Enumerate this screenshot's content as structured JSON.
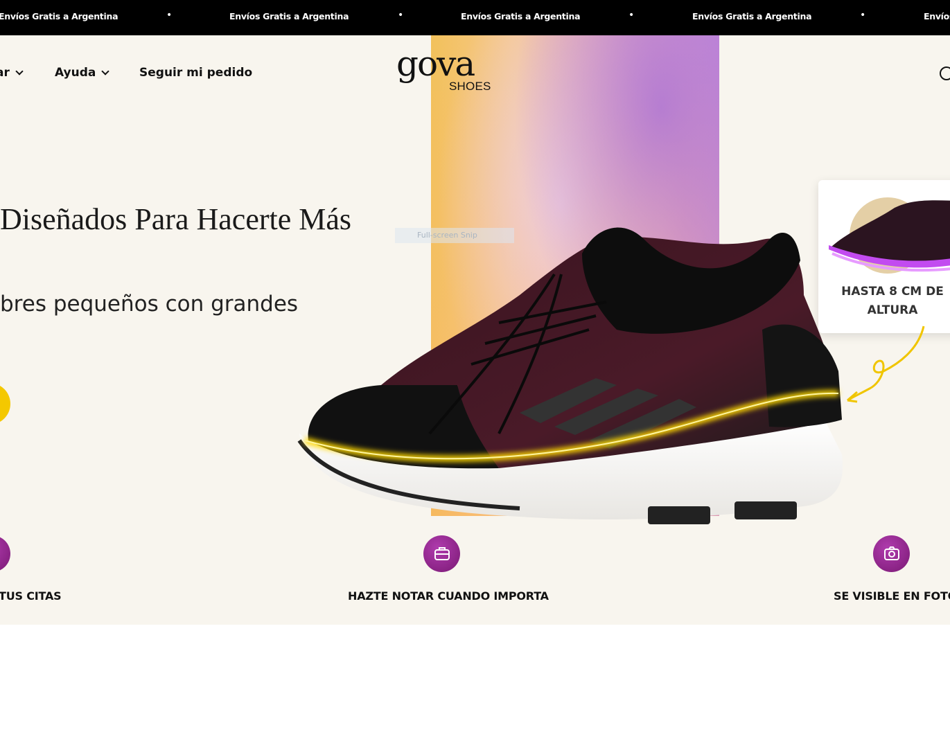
{
  "announcement": {
    "items": [
      "Envíos Gratis a Argentina",
      "Envíos Gratis a Argentina",
      "Envíos Gratis a Argentina",
      "Envíos Gratis a Argentina",
      "Envíos"
    ],
    "separator": "•"
  },
  "nav": {
    "item_partial": "ar",
    "help": "Ayuda",
    "track_order": "Seguir mi pedido"
  },
  "logo": {
    "main": "gova",
    "sub": "SHOES"
  },
  "hero": {
    "headline": "Diseñados Para Hacerte Más",
    "subheadline": "bres pequeños con grandes",
    "snip_overlay": "Full-screen Snip"
  },
  "badge": {
    "text": "HASTA 8 CM DE ALTURA"
  },
  "features": [
    {
      "label": "TUS CITAS",
      "icon": "heart-icon"
    },
    {
      "label": "HAZTE NOTAR CUANDO IMPORTA",
      "icon": "briefcase-icon"
    },
    {
      "label": "SE VISIBLE EN FOTOS",
      "icon": "camera-icon"
    }
  ],
  "colors": {
    "announcement_bg": "#000000",
    "hero_bg": "#f8f5ee",
    "accent_yellow": "#f4c800",
    "feature_purple": "#8a2385"
  }
}
